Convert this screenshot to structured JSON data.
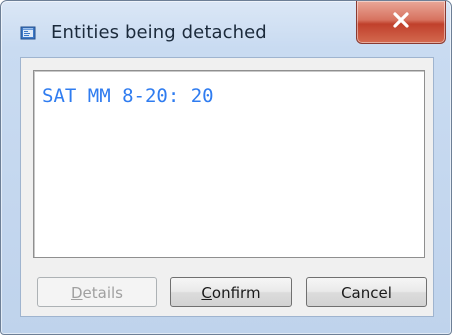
{
  "window": {
    "title": "Entities being detached",
    "app_icon": "app-window-icon",
    "close_icon": "close-x-icon"
  },
  "list": {
    "items": [
      "SAT MM 8-20: 20"
    ]
  },
  "buttons": {
    "details": {
      "first": "D",
      "rest": "etails",
      "enabled": false
    },
    "confirm": {
      "first": "C",
      "rest": "onfirm",
      "enabled": true
    },
    "cancel": {
      "label": "Cancel",
      "enabled": true
    }
  },
  "colors": {
    "list_text": "#2f7cf0",
    "close_button": "#c0402b"
  }
}
